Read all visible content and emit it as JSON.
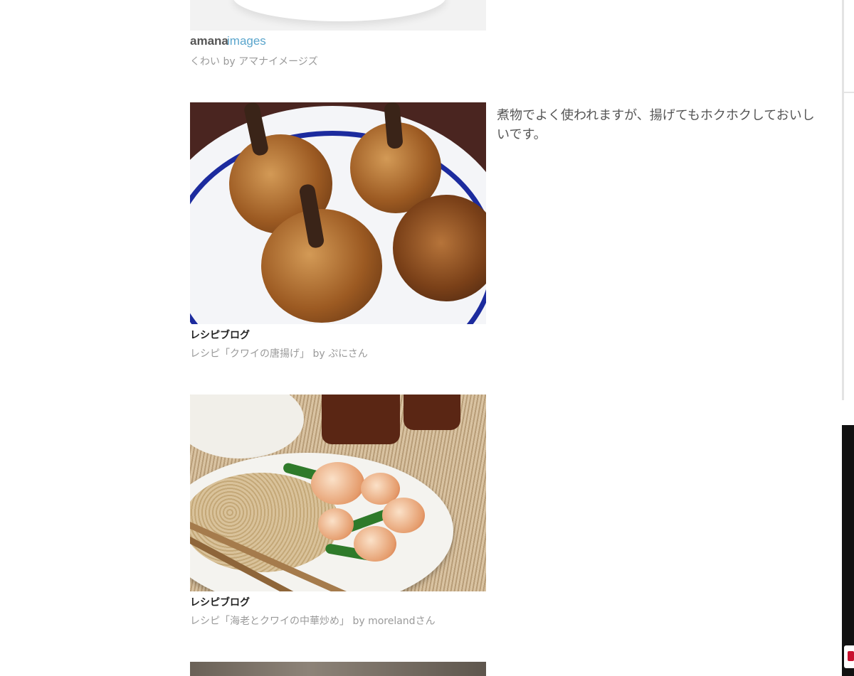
{
  "items": [
    {
      "source_logo": "amanaimages",
      "source_logo_parts": [
        "amana",
        "images"
      ],
      "caption": "くわい by アマナイメージズ"
    },
    {
      "source_logo": "レシピブログ",
      "caption": "レシピ「クワイの唐揚げ」 by ぷにさん",
      "text": "煮物でよく使われますが、揚げてもホクホクしておいしいです。"
    },
    {
      "source_logo": "レシピブログ",
      "caption": "レシピ「海老とクワイの中華炒め」 by morelandさん"
    }
  ],
  "colors": {
    "caption": "#9a9a9a",
    "body_text": "#555555",
    "logo_amana": "#555555",
    "logo_images": "#5aa5cc"
  },
  "recipe_logo_colors": [
    "#222222",
    "#e23a30",
    "#f29a1c",
    "#2d9f4a",
    "#2c6ec3",
    "#7b3fa0"
  ]
}
